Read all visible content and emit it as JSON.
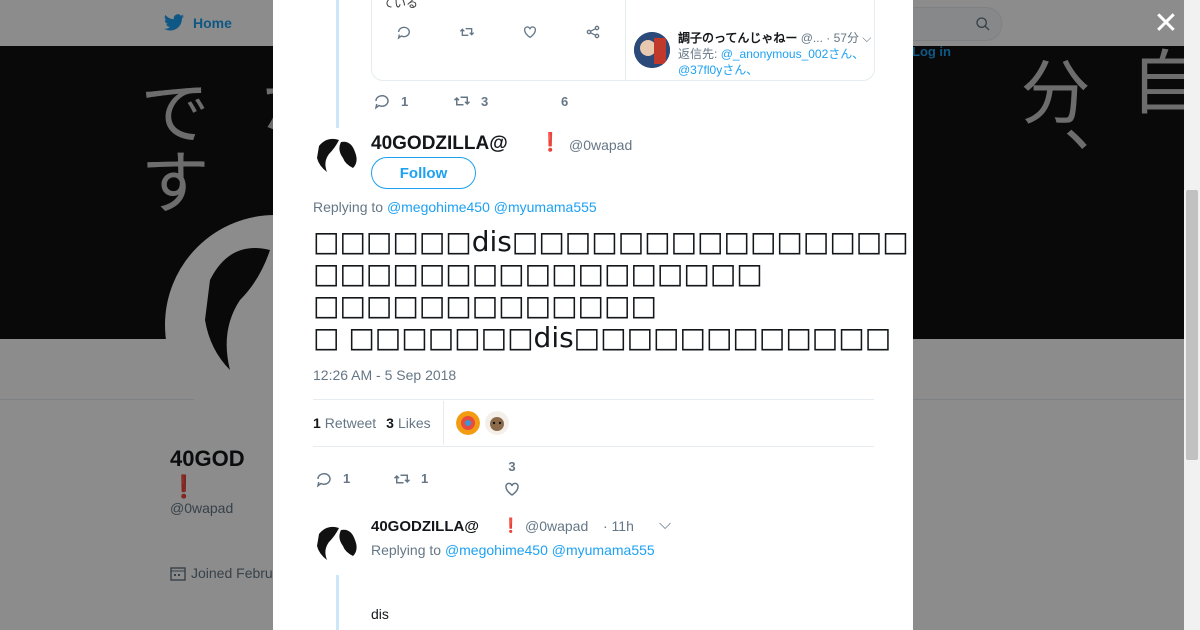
{
  "background": {
    "nav_home": "Home",
    "login": "Log in",
    "profile_name_line1": "40GOD",
    "profile_name_line2": "",
    "profile_handle": "@0wapad",
    "joined": "Joined Febru"
  },
  "modal": {
    "close_label": "✕",
    "quoted": {
      "left_text": "ている",
      "author_name": "調子のってんじゃねー",
      "author_meta": "@... · 57分",
      "reply_prefix": "返信先:",
      "reply_users": "@_anonymous_002さん、@37fl0yさん、"
    },
    "previous_actions": {
      "replies": "1",
      "retweets": "3",
      "likes": "6"
    },
    "tweet": {
      "display_name": "40GODZILLA@",
      "exclamation": "❗",
      "handle": "@0wapad",
      "follow_label": "Follow",
      "replying_prefix": "Replying to",
      "reply_users": "@megohime450 @myumama555",
      "text_lines": [
        "□□□□□□dis□□□□□□□□□□□□□□□",
        "□□□□□□□□□□□□□□□□□",
        "□□□□□□□□□□□□□",
        "□ □□□□□□□dis□□□□□□□□□□□□"
      ],
      "timestamp": "12:26 AM - 5 Sep 2018",
      "retweet_count": "1",
      "retweet_label": "Retweet",
      "like_count": "3",
      "like_label": "Likes",
      "actions": {
        "replies": "1",
        "retweets": "1",
        "likes": "3"
      }
    },
    "reply": {
      "display_name": "40GODZILLA@",
      "exclamation": "❗",
      "handle": "@0wapad",
      "time": "· 11h",
      "replying_prefix": "Replying to",
      "reply_users": "@megohime450 @myumama555",
      "text": "dis"
    }
  }
}
